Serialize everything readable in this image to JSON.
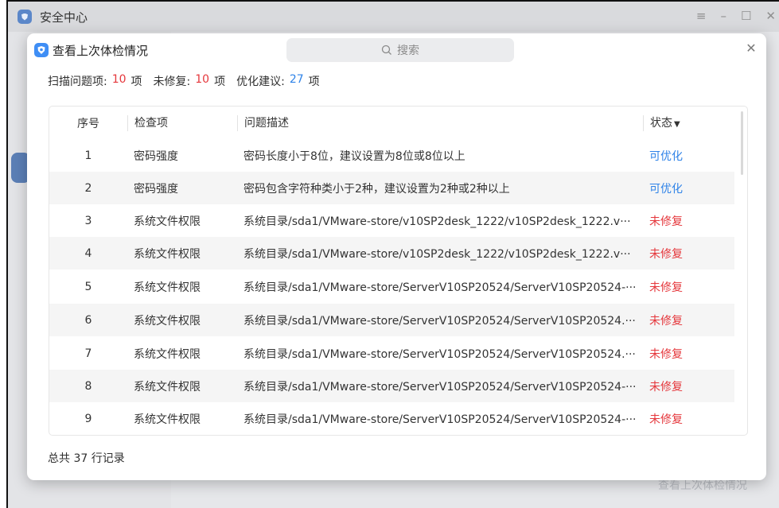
{
  "background": {
    "title": "安全中心",
    "controls": [
      "≡",
      "–",
      "☐",
      "✕"
    ],
    "bottom_link": "查看上次体检情况"
  },
  "dialog": {
    "title": "查看上次体检情况",
    "search_placeholder": "搜索",
    "close": "✕"
  },
  "summary": {
    "scan_label": "扫描问题项:",
    "scan_count": "10",
    "scan_unit": "项",
    "unfixed_label": "未修复:",
    "unfixed_count": "10",
    "unfixed_unit": "项",
    "advice_label": "优化建议:",
    "advice_count": "27",
    "advice_unit": "项"
  },
  "table": {
    "headers": {
      "seq": "序号",
      "item": "检查项",
      "desc": "问题描述",
      "state": "状态"
    },
    "rows": [
      {
        "seq": "1",
        "item": "密码强度",
        "desc": "密码长度小于8位，建议设置为8位或8位以上",
        "state": "可优化"
      },
      {
        "seq": "2",
        "item": "密码强度",
        "desc": "密码包含字符种类小于2种，建议设置为2种或2种以上",
        "state": "可优化"
      },
      {
        "seq": "3",
        "item": "系统文件权限",
        "desc": "系统目录/sda1/VMware-store/v10SP2desk_1222/v10SP2desk_1222.v···",
        "state": "未修复"
      },
      {
        "seq": "4",
        "item": "系统文件权限",
        "desc": "系统目录/sda1/VMware-store/v10SP2desk_1222/v10SP2desk_1222.v···",
        "state": "未修复"
      },
      {
        "seq": "5",
        "item": "系统文件权限",
        "desc": "系统目录/sda1/VMware-store/ServerV10SP20524/ServerV10SP20524-···",
        "state": "未修复"
      },
      {
        "seq": "6",
        "item": "系统文件权限",
        "desc": "系统目录/sda1/VMware-store/ServerV10SP20524/ServerV10SP20524.···",
        "state": "未修复"
      },
      {
        "seq": "7",
        "item": "系统文件权限",
        "desc": "系统目录/sda1/VMware-store/ServerV10SP20524/ServerV10SP20524.···",
        "state": "未修复"
      },
      {
        "seq": "8",
        "item": "系统文件权限",
        "desc": "系统目录/sda1/VMware-store/ServerV10SP20524/ServerV10SP20524-···",
        "state": "未修复"
      },
      {
        "seq": "9",
        "item": "系统文件权限",
        "desc": "系统目录/sda1/VMware-store/ServerV10SP20524/ServerV10SP20524-···",
        "state": "未修复"
      }
    ]
  },
  "footer": {
    "total": "总共 37 行记录"
  },
  "colors": {
    "red": "#e5373c",
    "blue": "#2f83e8",
    "accent": "#3f8ef5"
  }
}
